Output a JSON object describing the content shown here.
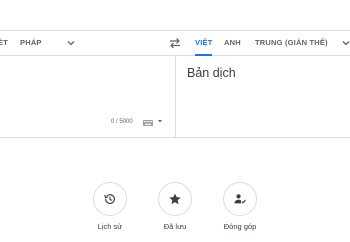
{
  "source_languages": [
    "ÉT",
    "PHÁP"
  ],
  "target_languages": [
    "VIỆT",
    "ANH",
    "TRUNG (GIẢN THỂ)"
  ],
  "active_target": "VIỆT",
  "char_counter": "0 / 5000",
  "translation_placeholder": "Bản dịch",
  "shortcuts": [
    {
      "label": "Lịch sử",
      "icon": "history-icon"
    },
    {
      "label": "Đã lưu",
      "icon": "star-icon"
    },
    {
      "label": "Đóng góp",
      "icon": "contribute-icon"
    }
  ],
  "colors": {
    "accent": "#1a73e8",
    "border": "#dadce0",
    "text": "#3c4043",
    "muted": "#5f6368"
  }
}
